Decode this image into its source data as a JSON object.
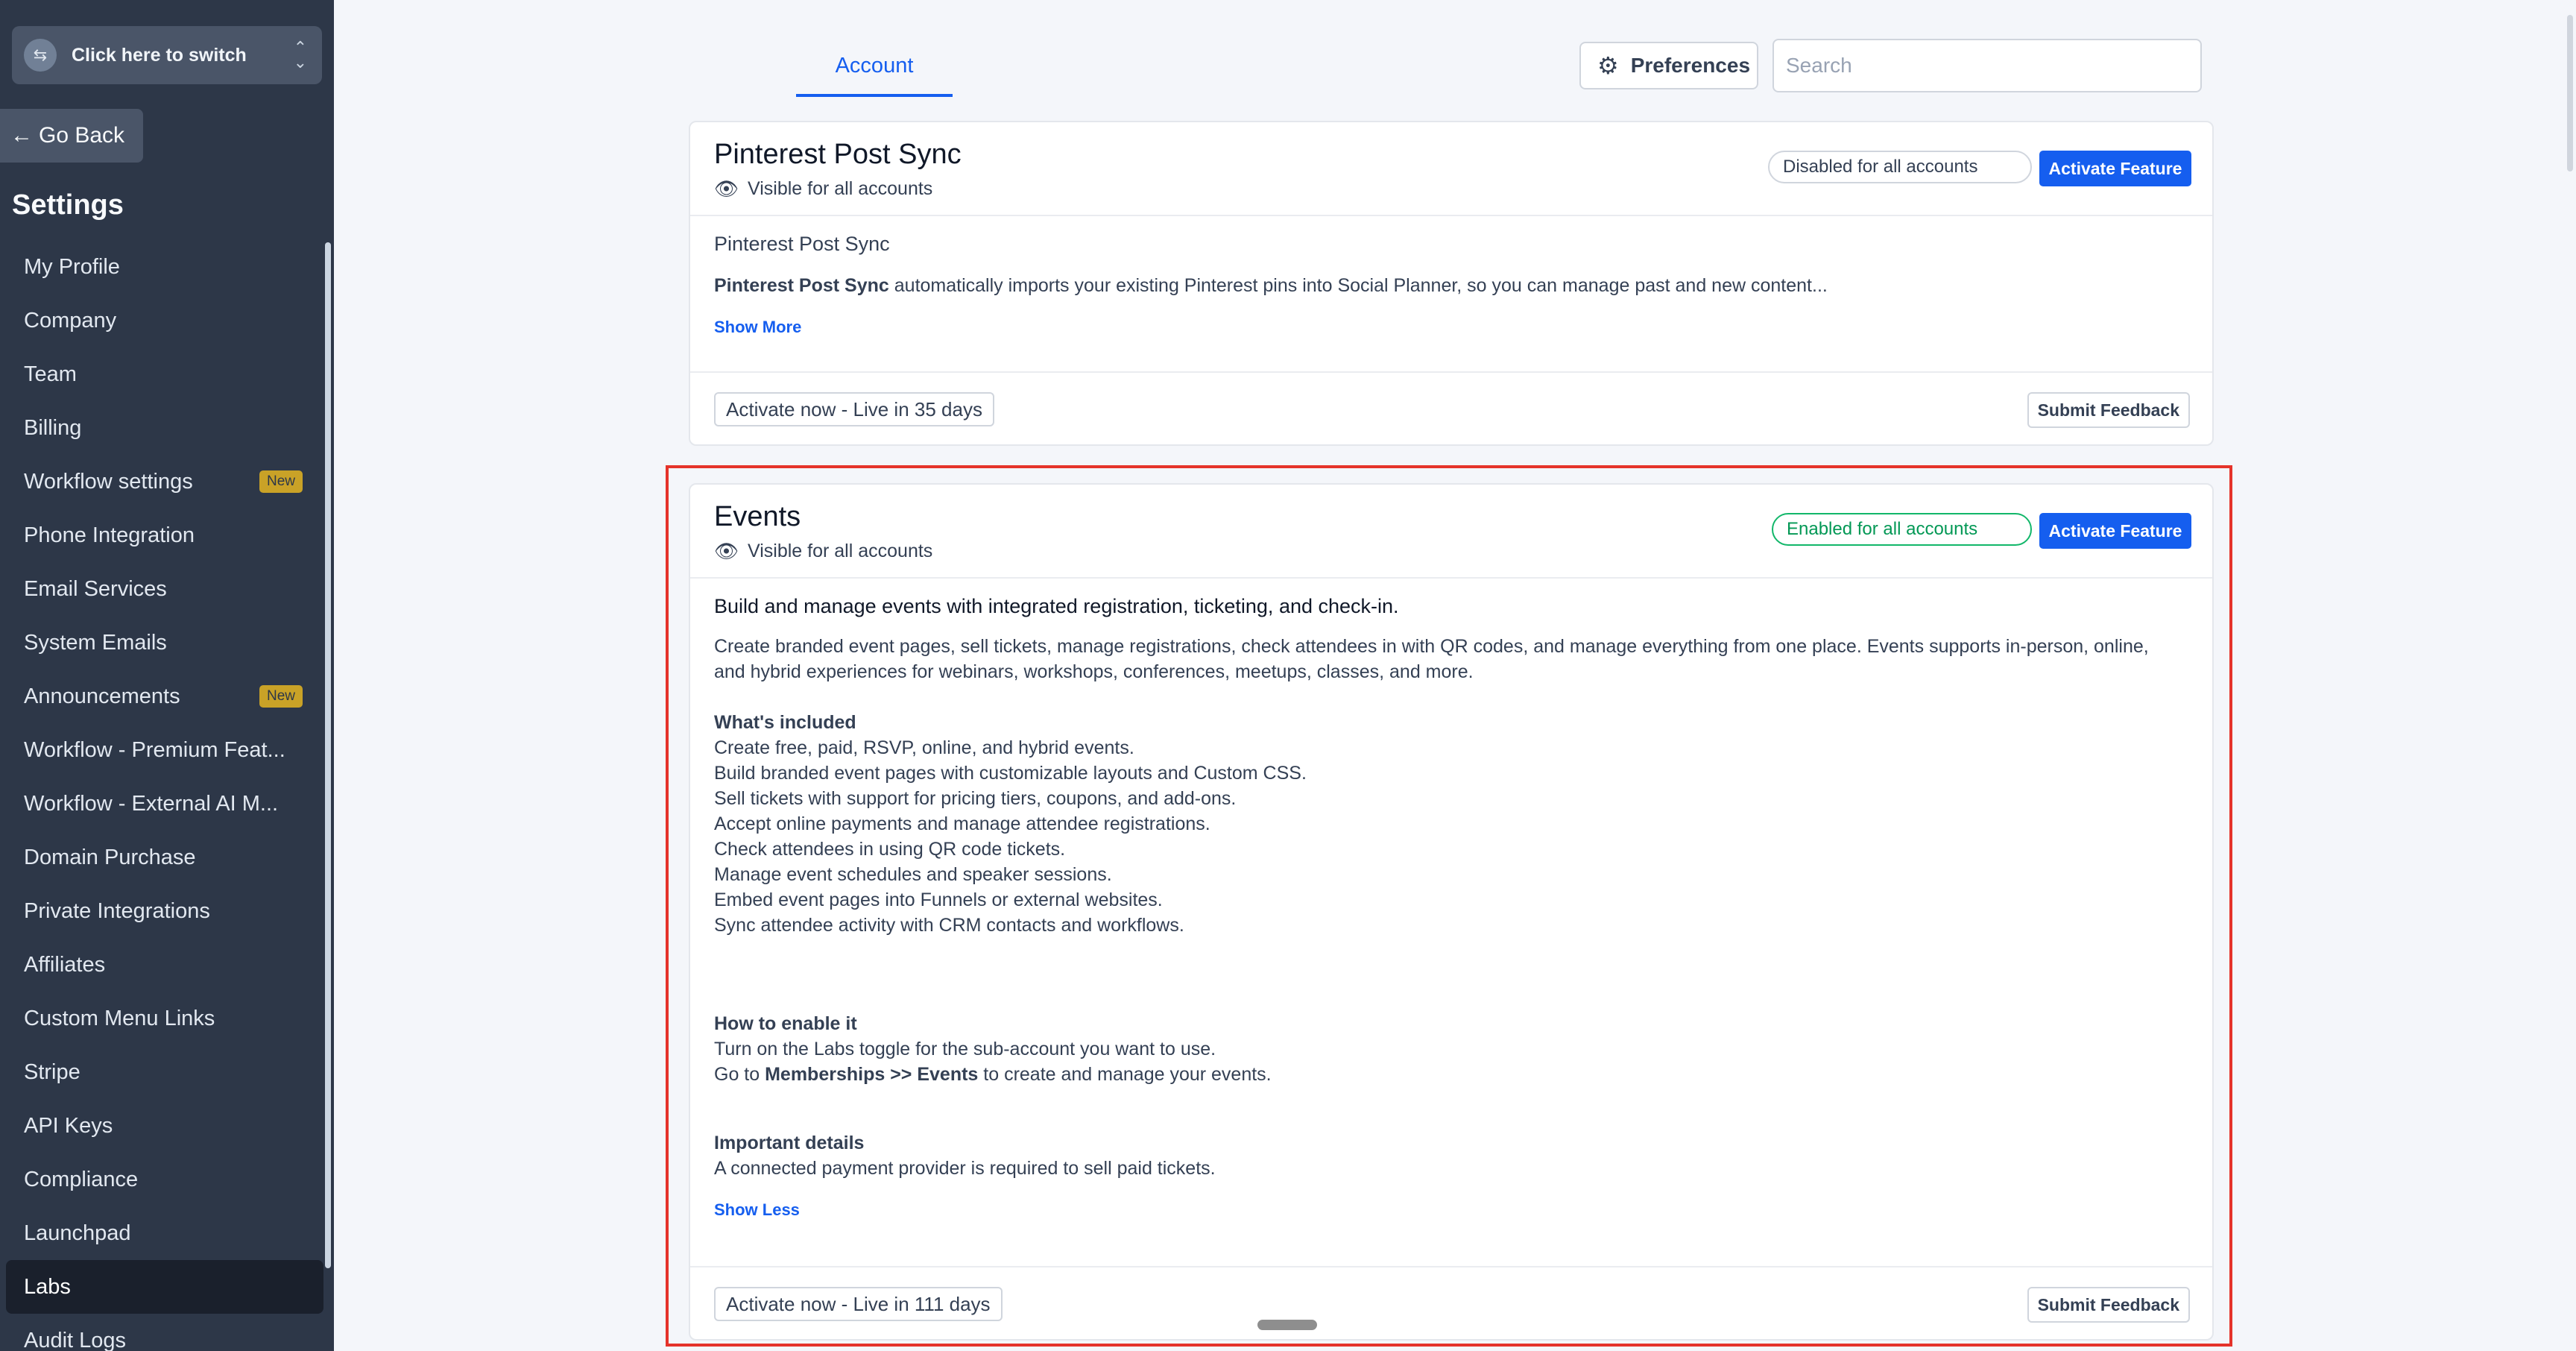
{
  "sidebar": {
    "switcher_label": "Click here to switch",
    "go_back_label": "Go Back",
    "settings_title": "Settings",
    "items": [
      {
        "label": "My Profile"
      },
      {
        "label": "Company"
      },
      {
        "label": "Team"
      },
      {
        "label": "Billing"
      },
      {
        "label": "Workflow settings",
        "badge": "New"
      },
      {
        "label": "Phone Integration"
      },
      {
        "label": "Email Services"
      },
      {
        "label": "System Emails"
      },
      {
        "label": "Announcements",
        "badge": "New"
      },
      {
        "label": "Workflow - Premium Feat..."
      },
      {
        "label": "Workflow - External AI M..."
      },
      {
        "label": "Domain Purchase"
      },
      {
        "label": "Private Integrations"
      },
      {
        "label": "Affiliates"
      },
      {
        "label": "Custom Menu Links"
      },
      {
        "label": "Stripe"
      },
      {
        "label": "API Keys"
      },
      {
        "label": "Compliance"
      },
      {
        "label": "Launchpad"
      },
      {
        "label": "Labs",
        "active": true
      },
      {
        "label": "Audit Logs"
      }
    ]
  },
  "topbar": {
    "tab_account": "Account",
    "preferences_label": "Preferences",
    "search_placeholder": "Search"
  },
  "cards": {
    "pinterest": {
      "title": "Pinterest Post Sync",
      "visibility": "Visible for all accounts",
      "status": "Disabled for all accounts",
      "activate_label": "Activate Feature",
      "subtitle": "Pinterest Post Sync",
      "desc_bold": "Pinterest Post Sync",
      "desc_rest": " automatically imports your existing Pinterest pins into Social Planner, so you can manage past and new content...",
      "show_more": "Show More",
      "live": "Activate now - Live in 35 days",
      "feedback": "Submit Feedback"
    },
    "events": {
      "title": "Events",
      "visibility": "Visible for all accounts",
      "status": "Enabled for all accounts",
      "activate_label": "Activate Feature",
      "headline": "Build and manage events with integrated registration, ticketing, and check-in.",
      "intro_line1": "Create branded event pages, sell tickets, manage registrations, check attendees in with QR codes, and manage everything from one place. Events supports in-person, online,",
      "intro_line2": "and hybrid experiences for webinars, workshops, conferences, meetups, classes, and more.",
      "included_heading": "What's included",
      "included": [
        "Create free, paid, RSVP, online, and hybrid events.",
        "Build branded event pages with customizable layouts and Custom CSS.",
        "Sell tickets with support for pricing tiers, coupons, and add-ons.",
        "Accept online payments and manage attendee registrations.",
        "Check attendees in using QR code tickets.",
        "Manage event schedules and speaker sessions.",
        "Embed event pages into Funnels or external websites.",
        "Sync attendee activity with CRM contacts and workflows."
      ],
      "enable_heading": "How to enable it",
      "enable_line1": "Turn on the Labs toggle for the sub-account you want to use.",
      "enable_line2_pre": "Go to ",
      "enable_line2_bold": "Memberships >> Events",
      "enable_line2_post": " to create and manage your events.",
      "details_heading": "Important details",
      "details_line": "A connected payment provider is required to sell paid tickets.",
      "show_less": "Show Less",
      "live": "Activate now - Live in 111 days",
      "feedback": "Submit Feedback"
    }
  },
  "colors": {
    "sidebar_bg": "#2d3748",
    "accent": "#155eef",
    "enabled_green": "#039855",
    "highlight_red": "#e5332a",
    "badge_gold": "#c9a227"
  }
}
